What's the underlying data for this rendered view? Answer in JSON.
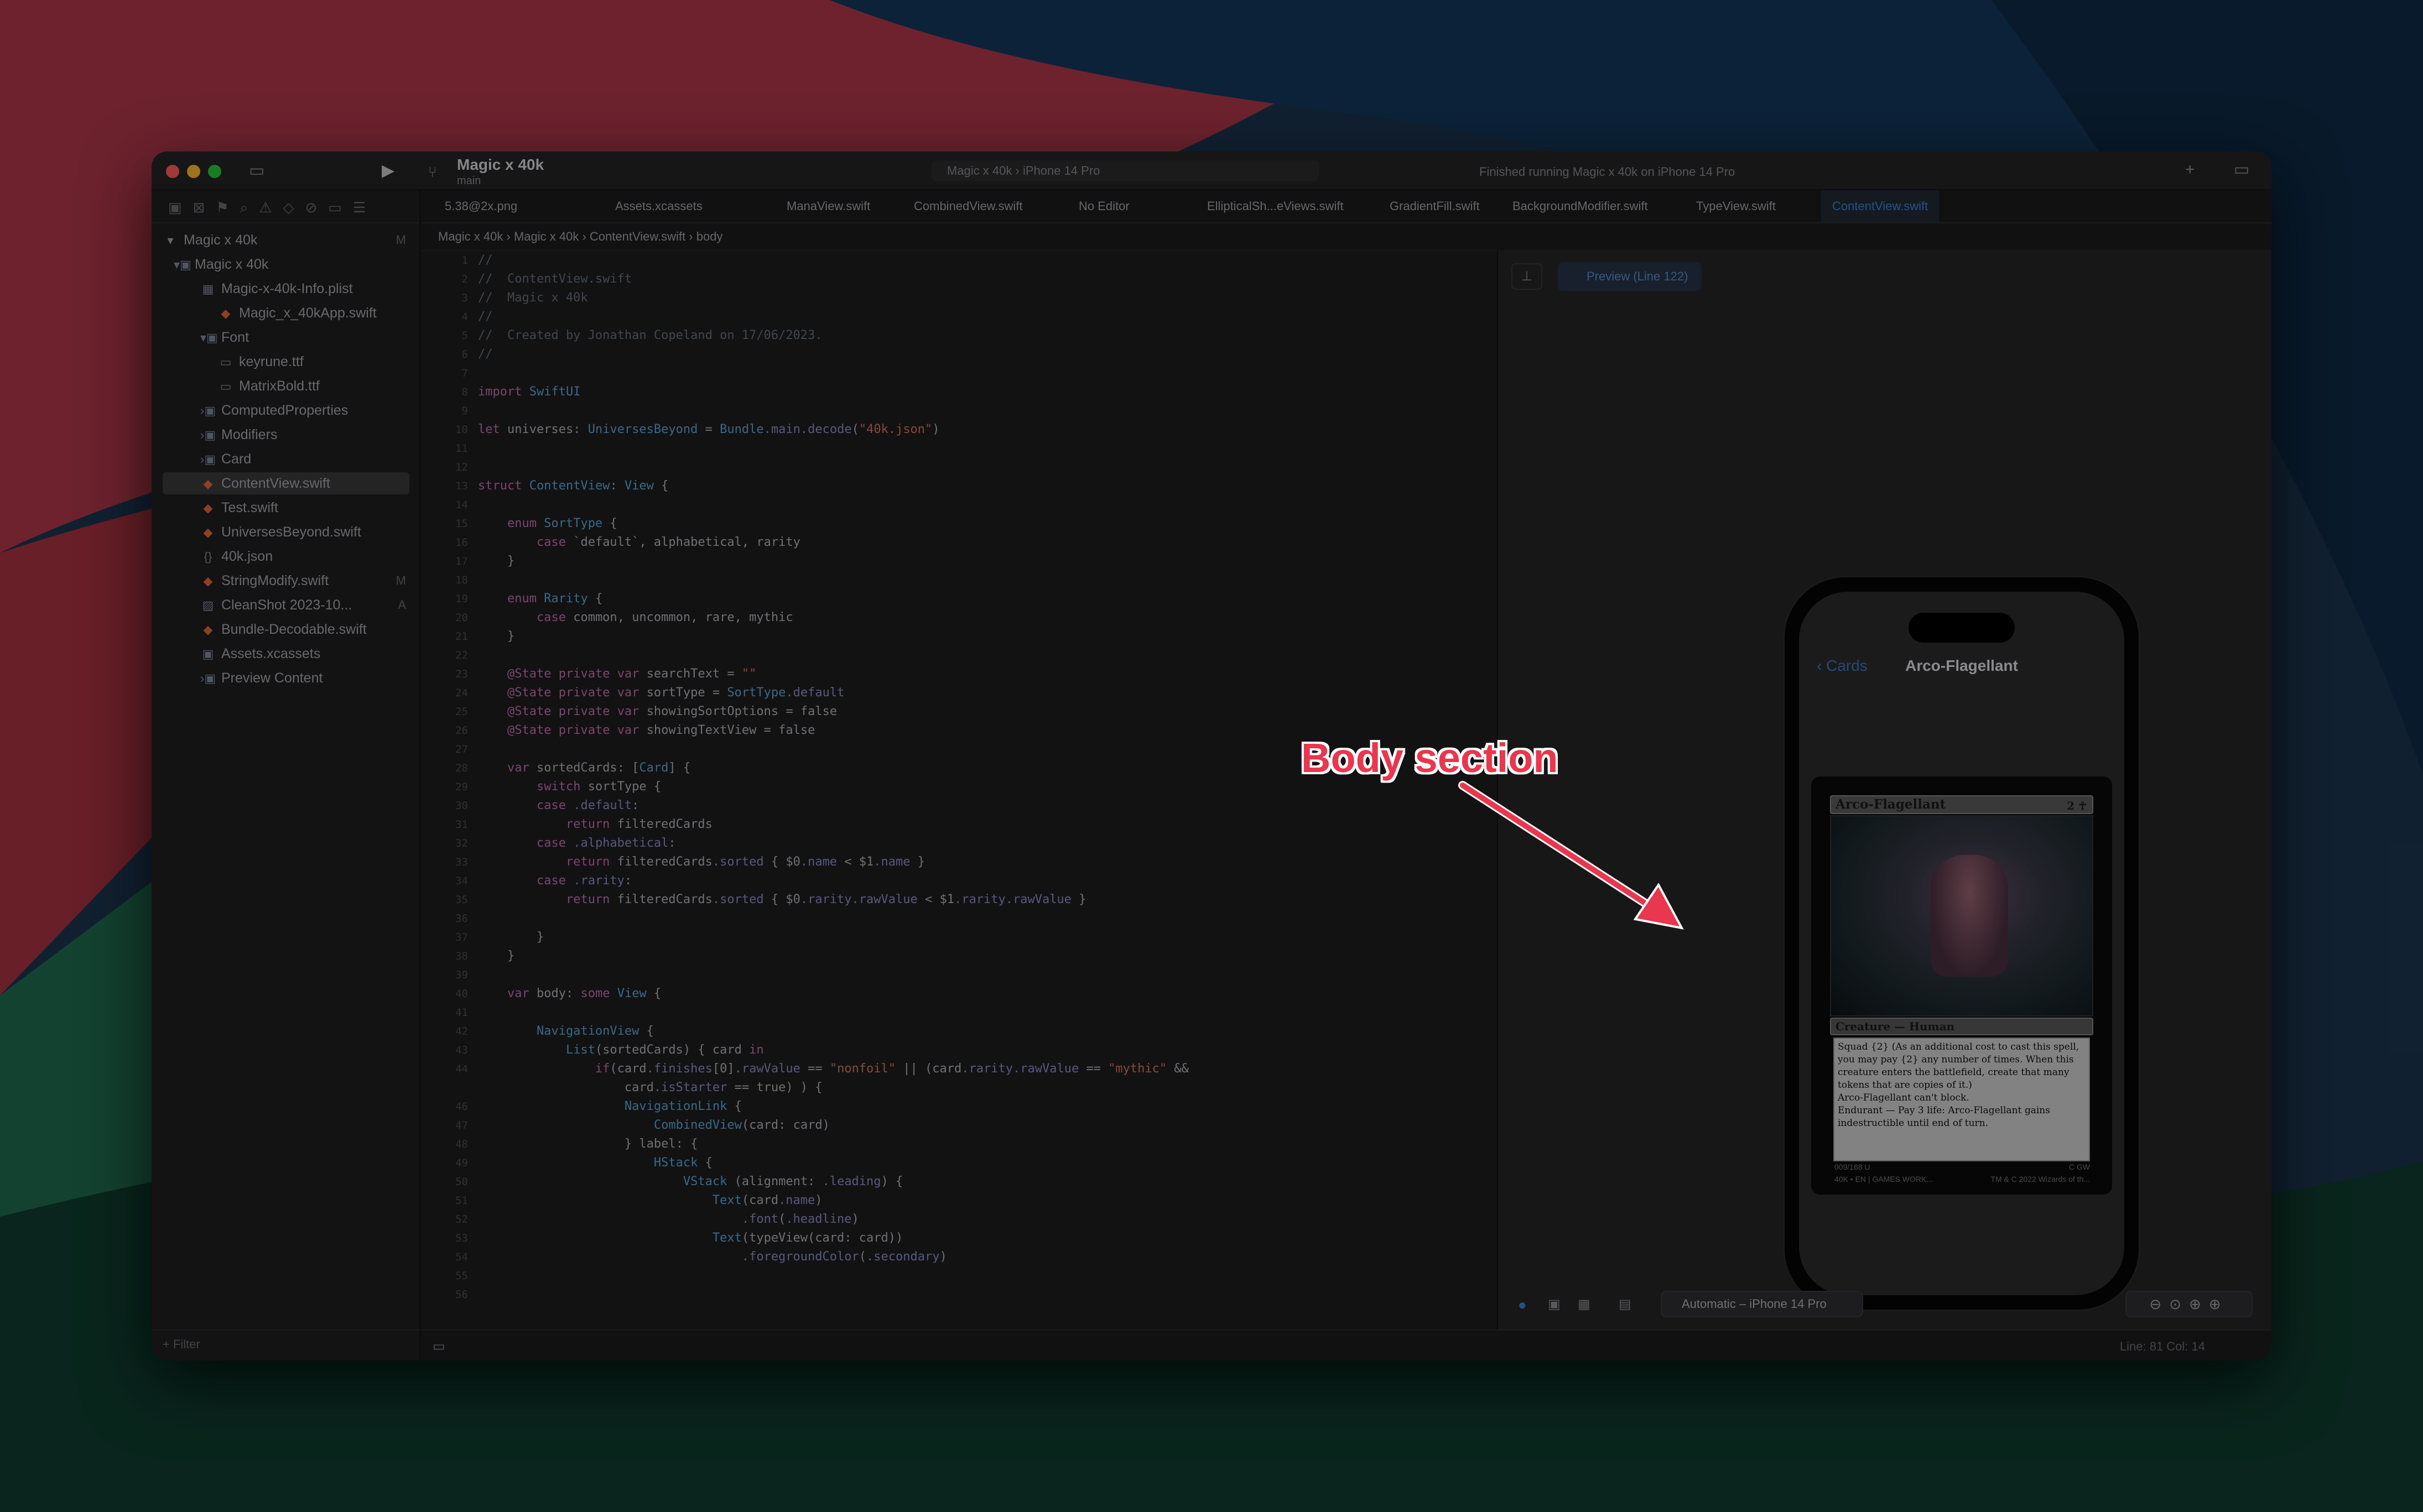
{
  "window": {
    "title": "Magic x 40k",
    "branch": "main",
    "scheme": "Magic x 40k",
    "device": "iPhone 14 Pro",
    "status": "Finished running Magic x 40k on iPhone 14 Pro"
  },
  "tabs": [
    "5.38@2x.png",
    "Assets.xcassets",
    "ManaView.swift",
    "CombinedView.swift",
    "No Editor",
    "EllipticalSh...eViews.swift",
    "GradientFill.swift",
    "BackgroundModifier.swift",
    "TypeView.swift",
    "ContentView.swift"
  ],
  "breadcrumb": [
    "Magic x 40k",
    "Magic x 40k",
    "ContentView.swift",
    "body"
  ],
  "navigator": {
    "project": "Magic x 40k",
    "project_badge": "M",
    "items": [
      {
        "label": "Magic x 40k",
        "badge": ""
      },
      {
        "label": "Magic-x-40k-Info.plist",
        "badge": ""
      },
      {
        "label": "Magic_x_40kApp.swift",
        "badge": ""
      },
      {
        "label": "Font",
        "badge": ""
      },
      {
        "label": "keyrune.ttf",
        "badge": ""
      },
      {
        "label": "MatrixBold.ttf",
        "badge": ""
      },
      {
        "label": "ComputedProperties",
        "badge": ""
      },
      {
        "label": "Modifiers",
        "badge": ""
      },
      {
        "label": "Card",
        "badge": ""
      },
      {
        "label": "ContentView.swift",
        "badge": ""
      },
      {
        "label": "Test.swift",
        "badge": ""
      },
      {
        "label": "UniversesBeyond.swift",
        "badge": ""
      },
      {
        "label": "40k.json",
        "badge": ""
      },
      {
        "label": "StringModify.swift",
        "badge": "M"
      },
      {
        "label": "CleanShot 2023-10...",
        "badge": "A"
      },
      {
        "label": "Bundle-Decodable.swift",
        "badge": ""
      },
      {
        "label": "Assets.xcassets",
        "badge": ""
      },
      {
        "label": "Preview Content",
        "badge": ""
      }
    ],
    "filter_placeholder": "Filter"
  },
  "code": {
    "line_numbers": [
      "1",
      "2",
      "3",
      "4",
      "5",
      "6",
      "7",
      "8",
      "9",
      "10",
      "11",
      "12",
      "13",
      "14",
      "15",
      "16",
      "17",
      "18",
      "19",
      "20",
      "21",
      "22",
      "23",
      "24",
      "25",
      "26",
      "27",
      "28",
      "29",
      "30",
      "31",
      "32",
      "33",
      "34",
      "35",
      "36",
      "37",
      "38",
      "39",
      "40",
      "41",
      "42",
      "43",
      "44",
      "",
      "46",
      "47",
      "48",
      "49",
      "50",
      "51",
      "52",
      "53",
      "54",
      "55",
      "56"
    ],
    "lines": [
      "//",
      "//  ContentView.swift",
      "//  Magic x 40k",
      "//",
      "//  Created by Jonathan Copeland on 17/06/2023.",
      "//",
      "",
      "import SwiftUI",
      "",
      "let universes: UniversesBeyond = Bundle.main.decode(\"40k.json\")",
      "",
      "",
      "struct ContentView: View {",
      "",
      "    enum SortType {",
      "        case `default`, alphabetical, rarity",
      "    }",
      "",
      "    enum Rarity {",
      "        case common, uncommon, rare, mythic",
      "    }",
      "",
      "    @State private var searchText = \"\"",
      "    @State private var sortType = SortType.default",
      "    @State private var showingSortOptions = false",
      "    @State private var showingTextView = false",
      "",
      "    var sortedCards: [Card] {",
      "        switch sortType {",
      "        case .default:",
      "            return filteredCards",
      "        case .alphabetical:",
      "            return filteredCards.sorted { $0.name < $1.name }",
      "        case .rarity:",
      "            return filteredCards.sorted { $0.rarity.rawValue < $1.rarity.rawValue }",
      "",
      "        }",
      "    }",
      "",
      "    var body: some View {",
      "",
      "        NavigationView {",
      "            List(sortedCards) { card in",
      "                if(card.finishes[0].rawValue == \"nonfoil\" || (card.rarity.rawValue == \"mythic\" &&",
      "                    card.isStarter == true) ) {",
      "                    NavigationLink {",
      "                        CombinedView(card: card)",
      "                    } label: {",
      "                        HStack {",
      "                            VStack (alignment: .leading) {",
      "                                Text(card.name)",
      "                                    .font(.headline)",
      "                                Text(typeView(card: card))",
      "                                    .foregroundColor(.secondary)",
      "",
      ""
    ]
  },
  "preview": {
    "button_label": "Preview (Line 122)",
    "device_selector": "Automatic – iPhone 14 Pro",
    "back_label": "Cards",
    "nav_title": "Arco-Flagellant",
    "card": {
      "name": "Arco-Flagellant",
      "mana_cost": "2 ☥",
      "type_line": "Creature — Human",
      "rules": [
        "Squad {2} (As an additional cost to cast this spell, you may pay {2} any number of times. When this creature enters the battlefield, create that many tokens that are copies of it.)",
        "Arco-Flagellant can't block.",
        "Endurant — Pay 3 life: Arco-Flagellant gains indestructible until end of turn."
      ],
      "collector": "009/168 U",
      "set_line": "40K • EN | GAMES WORK...",
      "copyright": "TM & C 2022 Wizards of th...",
      "power": "C GW"
    }
  },
  "statusbar": {
    "position": "Line: 81  Col: 14"
  },
  "annotation": {
    "label": "Body section"
  },
  "colors": {
    "accent": "#3b82d6",
    "annotation": "#e8374e"
  }
}
